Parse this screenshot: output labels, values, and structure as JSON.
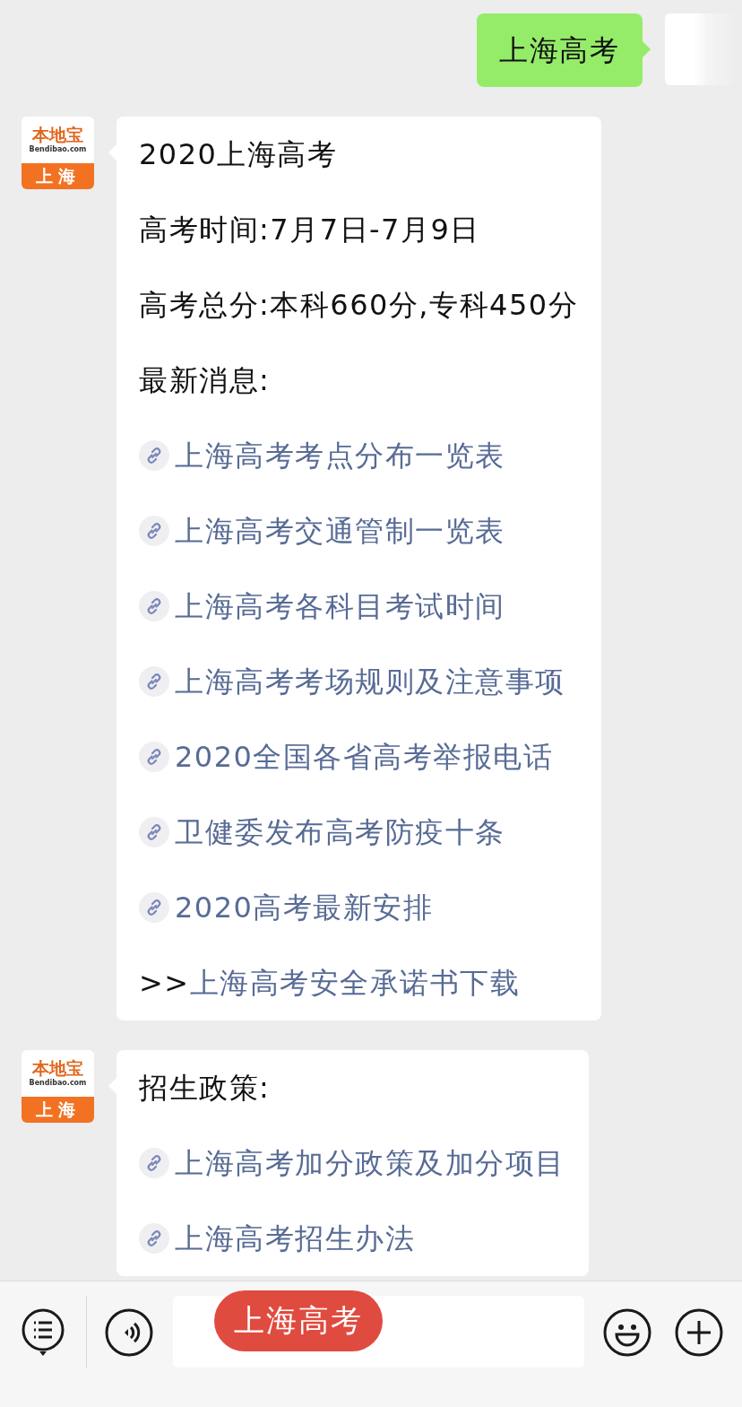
{
  "messages": [
    {
      "kind": "outgoing",
      "lines": [
        {
          "kind": "text",
          "text": "上海高考"
        }
      ]
    },
    {
      "kind": "incoming",
      "avatar": {
        "brand": "本地宝",
        "domain": "Bendibao.com",
        "city": "上海"
      },
      "lines": [
        {
          "kind": "text",
          "text": "2020上海高考"
        },
        {
          "kind": "text",
          "text": "高考时间:7月7日-7月9日"
        },
        {
          "kind": "text",
          "text": "高考总分:本科660分,专科450分"
        },
        {
          "kind": "text",
          "text": "最新消息:"
        },
        {
          "kind": "link",
          "text": "上海高考考点分布一览表"
        },
        {
          "kind": "link",
          "text": "上海高考交通管制一览表"
        },
        {
          "kind": "link",
          "text": "上海高考各科目考试时间"
        },
        {
          "kind": "link",
          "text": "上海高考考场规则及注意事项"
        },
        {
          "kind": "link",
          "text": "2020全国各省高考举报电话"
        },
        {
          "kind": "link",
          "text": "卫健委发布高考防疫十条"
        },
        {
          "kind": "link",
          "text": "2020高考最新安排"
        },
        {
          "kind": "prefixed_link",
          "prefix": ">>",
          "text": "上海高考安全承诺书下载"
        }
      ]
    },
    {
      "kind": "incoming",
      "avatar": {
        "brand": "本地宝",
        "domain": "Bendibao.com",
        "city": "上海"
      },
      "lines": [
        {
          "kind": "text",
          "text": "招生政策:"
        },
        {
          "kind": "link",
          "text": "上海高考加分政策及加分项目"
        },
        {
          "kind": "link",
          "text": "上海高考招生办法"
        }
      ]
    }
  ],
  "input_bar": {
    "tag": "上海高考"
  }
}
